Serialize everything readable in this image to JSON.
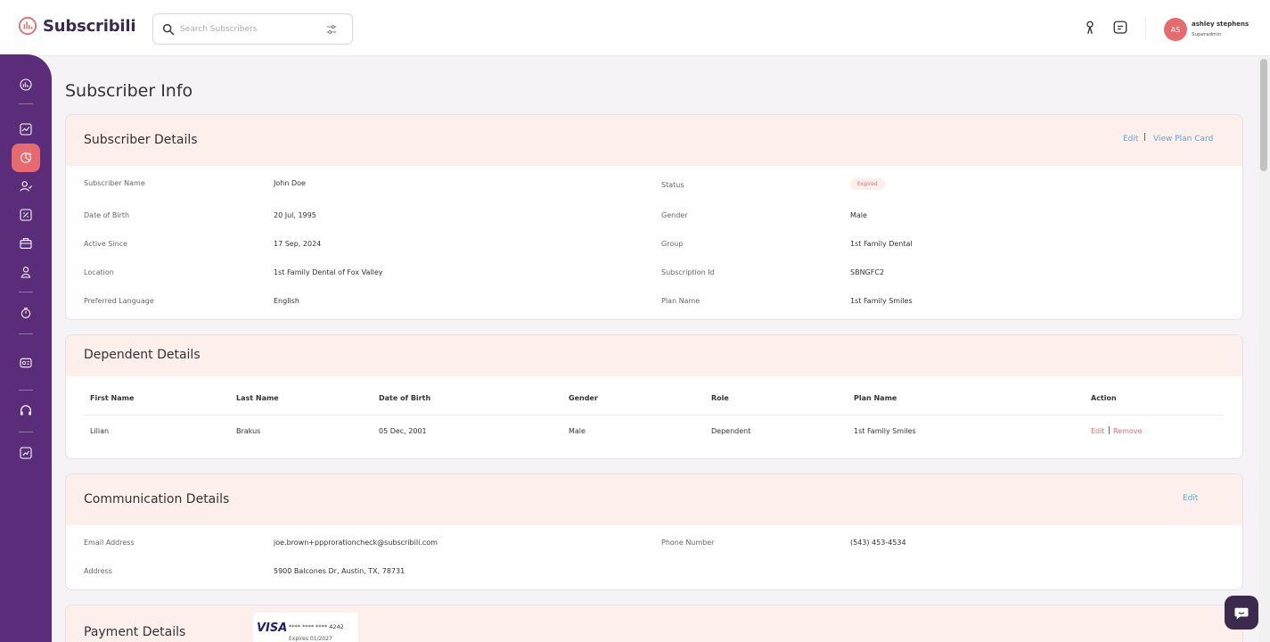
{
  "app": {
    "name": "Subscribili"
  },
  "search": {
    "placeholder": "Search Subscribers"
  },
  "user": {
    "initials": "AS",
    "name": "ashley stephens",
    "role": "Superadmin"
  },
  "page": {
    "title": "Subscriber Info"
  },
  "subscriber_details": {
    "title": "Subscriber Details",
    "edit_label": "Edit",
    "separator": "|",
    "view_plan_label": "View Plan Card",
    "left": [
      {
        "label": "Subscriber Name",
        "value": "John Doe"
      },
      {
        "label": "Date of Birth",
        "value": "20 Jul, 1995"
      },
      {
        "label": "Active Since",
        "value": "17 Sep, 2024"
      },
      {
        "label": "Location",
        "value": "1st Family Dental of Fox Valley"
      },
      {
        "label": "Preferred Language",
        "value": "English"
      }
    ],
    "right": [
      {
        "label": "Status",
        "value": "Expired"
      },
      {
        "label": "Gender",
        "value": "Male"
      },
      {
        "label": "Group",
        "value": "1st Family Dental"
      },
      {
        "label": "Subscription Id",
        "value": "SBNGFC2"
      },
      {
        "label": "Plan Name",
        "value": "1st Family Smiles"
      }
    ]
  },
  "dependent_details": {
    "title": "Dependent Details",
    "columns": [
      "First Name",
      "Last Name",
      "Date of Birth",
      "Gender",
      "Role",
      "Plan Name",
      "Action"
    ],
    "rows": [
      {
        "first_name": "Lilian",
        "last_name": "Brakus",
        "dob": "05 Dec, 2001",
        "gender": "Male",
        "role": "Dependent",
        "plan_name": "1st Family Smiles",
        "edit_label": "Edit",
        "separator": "|",
        "remove_label": "Remove"
      }
    ]
  },
  "communication_details": {
    "title": "Communication Details",
    "edit_label": "Edit",
    "email_label": "Email Address",
    "email_value": "joe.brown+ppprorationcheck@subscribili.com",
    "phone_label": "Phone Number",
    "phone_value": "(543) 453-4534",
    "address_label": "Address",
    "address_value": "5900 Balcones Dr, Austin, TX, 78731"
  },
  "payment_details": {
    "title": "Payment Details",
    "card_brand": "VISA",
    "card_number": "**** **** **** 4242",
    "card_expiry": "Expires 01/2027"
  },
  "colors": {
    "sidebar": "#5b2c7a",
    "accent": "#e56b6f",
    "link": "#5aa9d6",
    "card_header": "#fcefec"
  },
  "icons": {
    "sidebar": [
      "dashboard-icon",
      "analytics-icon",
      "subscriptions-icon",
      "users-icon",
      "discount-icon",
      "plans-icon",
      "members-icon",
      "settings-icon",
      "billing-icon",
      "support-icon",
      "reports-icon"
    ],
    "topbar": [
      "search-icon",
      "filter-icon",
      "user-icon",
      "message-icon"
    ]
  }
}
